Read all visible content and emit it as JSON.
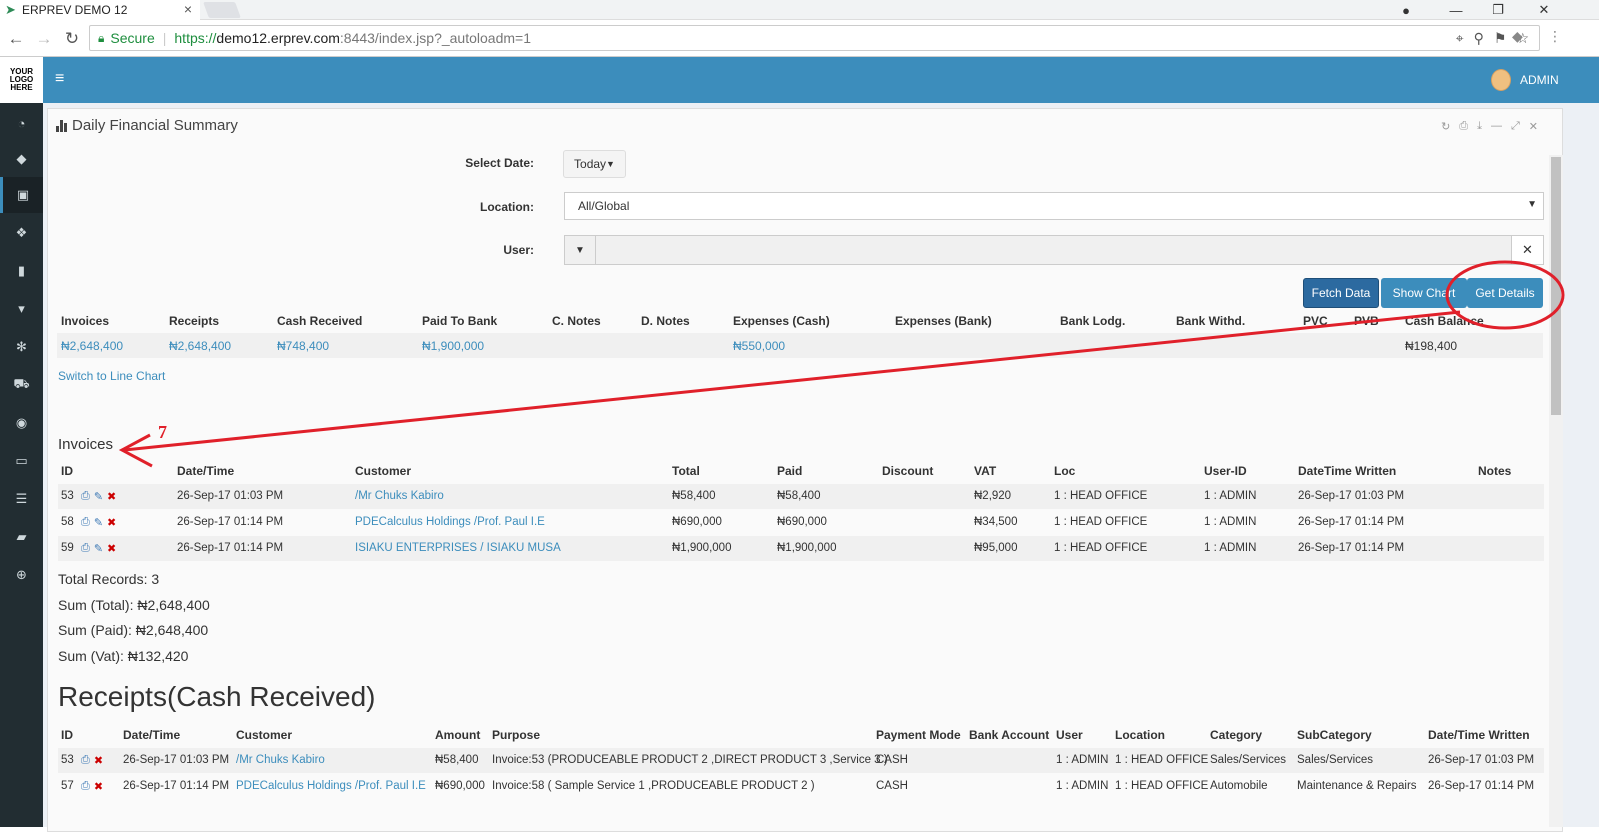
{
  "browser": {
    "tab_title": "ERPREV DEMO 12",
    "secure_label": "Secure",
    "url_proto": "https://",
    "url_host": "demo12.erprev.com",
    "url_rest": ":8443/index.jsp?_autoloadm=1"
  },
  "logo": {
    "l1": "YOUR",
    "l2": "LOGO",
    "l3": "HERE"
  },
  "header": {
    "user": "ADMIN"
  },
  "panel": {
    "title": "Daily Financial Summary"
  },
  "form": {
    "date_label": "Select Date:",
    "date_value": "Today",
    "location_label": "Location:",
    "location_value": "All/Global",
    "user_label": "User:",
    "fetch_label": "Fetch Data",
    "chart_label": "Show Chart",
    "details_label": "Get Details"
  },
  "summary": {
    "headers": [
      "Invoices",
      "Receipts",
      "Cash Received",
      "Paid To Bank",
      "C. Notes",
      "D. Notes",
      "Expenses (Cash)",
      "Expenses (Bank)",
      "Bank Lodg.",
      "Bank Withd.",
      "PVC",
      "PVB",
      "Cash Balance"
    ],
    "values": [
      "₦2,648,400",
      "₦2,648,400",
      "₦748,400",
      "₦1,900,000",
      "",
      "",
      "₦550,000",
      "",
      "",
      "",
      "",
      "",
      "₦198,400"
    ],
    "switch_link": "Switch to Line Chart"
  },
  "annotation": {
    "number": "7",
    "color": "#e0202a"
  },
  "invoices": {
    "title": "Invoices",
    "headers": [
      "ID",
      "Date/Time",
      "Customer",
      "Total",
      "Paid",
      "Discount",
      "VAT",
      "Loc",
      "User-ID",
      "DateTime Written",
      "Notes"
    ],
    "rows": [
      [
        "53",
        "26-Sep-17 01:03 PM",
        "/Mr Chuks Kabiro",
        "₦58,400",
        "₦58,400",
        "",
        "₦2,920",
        "1 : HEAD OFFICE",
        "1 : ADMIN",
        "26-Sep-17 01:03 PM",
        ""
      ],
      [
        "58",
        "26-Sep-17 01:14 PM",
        "PDECalculus Holdings /Prof. Paul I.E",
        "₦690,000",
        "₦690,000",
        "",
        "₦34,500",
        "1 : HEAD OFFICE",
        "1 : ADMIN",
        "26-Sep-17 01:14 PM",
        ""
      ],
      [
        "59",
        "26-Sep-17 01:14 PM",
        "ISIAKU ENTERPRISES / ISIAKU MUSA",
        "₦1,900,000",
        "₦1,900,000",
        "",
        "₦95,000",
        "1 : HEAD OFFICE",
        "1 : ADMIN",
        "26-Sep-17 01:14 PM",
        ""
      ]
    ],
    "total_records": "Total Records: 3",
    "sum_total": "Sum (Total): ₦2,648,400",
    "sum_paid": "Sum (Paid): ₦2,648,400",
    "sum_vat": "Sum (Vat): ₦132,420"
  },
  "receipts": {
    "title": "Receipts(Cash Received)",
    "headers": [
      "ID",
      "Date/Time",
      "Customer",
      "Amount",
      "Purpose",
      "Payment Mode",
      "Bank Account",
      "User",
      "Location",
      "Category",
      "SubCategory",
      "Date/Time Written"
    ],
    "rows": [
      [
        "53",
        "26-Sep-17 01:03 PM",
        "/Mr Chuks Kabiro",
        "₦58,400",
        "Invoice:53 (PRODUCEABLE PRODUCT 2 ,DIRECT PRODUCT 3 ,Service 3 )",
        "CASH",
        "",
        "1 : ADMIN",
        "1 : HEAD OFFICE",
        "Sales/Services",
        "Sales/Services",
        "26-Sep-17 01:03 PM"
      ],
      [
        "57",
        "26-Sep-17 01:14 PM",
        "PDECalculus Holdings /Prof. Paul I.E",
        "₦690,000",
        "Invoice:58 ( Sample Service 1 ,PRODUCEABLE PRODUCT 2 )",
        "CASH",
        "",
        "1 : ADMIN",
        "1 : HEAD OFFICE",
        "Automobile",
        "Maintenance & Repairs",
        "26-Sep-17 01:14 PM"
      ]
    ]
  }
}
